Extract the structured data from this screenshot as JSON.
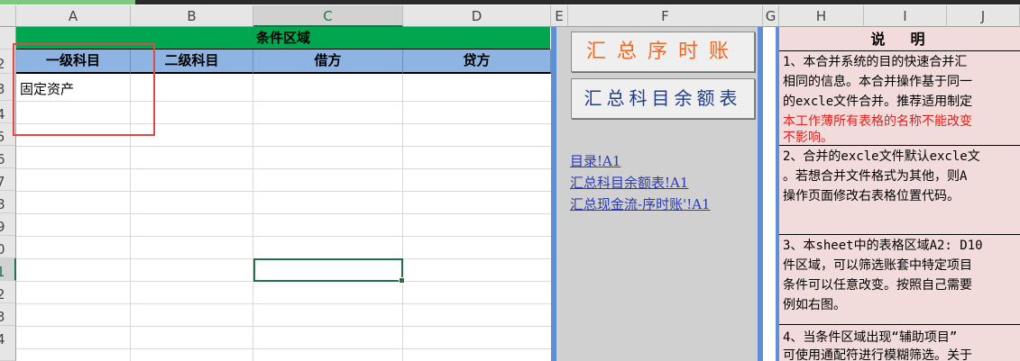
{
  "column_headers": [
    "A",
    "B",
    "C",
    "D",
    "E",
    "F",
    "G",
    "H",
    "I",
    "J"
  ],
  "row_headers": [
    "2",
    "2",
    "3",
    "4",
    "5",
    "6",
    "7",
    "8",
    "9",
    "0",
    "1",
    "2",
    "3",
    "4"
  ],
  "condition_area": {
    "title": "条件区域",
    "headers": [
      "一级科目",
      "二级科目",
      "借方",
      "贷方"
    ],
    "cell_a3": "固定资产"
  },
  "buttons": {
    "summary_journal": "汇总序时账",
    "summary_balance": "汇总科目余额表"
  },
  "links": [
    "目录!A1",
    "汇总科目余额表!A1",
    "汇总现金流-序时账'!A1"
  ],
  "notes": {
    "title": "说明",
    "para1": [
      "1、本合并系统的目的快速合并汇",
      "相同的信息。本合并操作基于同一",
      "的excle文件合并。推荐适用制定"
    ],
    "para1_red": [
      "本工作薄所有表格的名称不能改变",
      "不影响。"
    ],
    "para2": [
      "2、合并的excle文件默认excle文",
      "。若想合并文件格式为其他，则A",
      "操作页面修改右表格位置代码。"
    ],
    "para3": [
      "3、本sheet中的表格区域A2: D10",
      "件区域，可以筛选账套中特定项目",
      "条件可以任意改变。按照自己需要",
      "例如右图。"
    ],
    "para4": [
      "4、当条件区域出现“辅助项目”",
      "可使用通配符进行模糊筛选。关于"
    ]
  },
  "colors": {
    "banner": "#00a650",
    "header_fill": "#8db4e2",
    "selection": "#217346",
    "annotation_box": "#e04848",
    "notes_bg": "#f2dcdb",
    "panel_border": "#5b8fd6"
  }
}
